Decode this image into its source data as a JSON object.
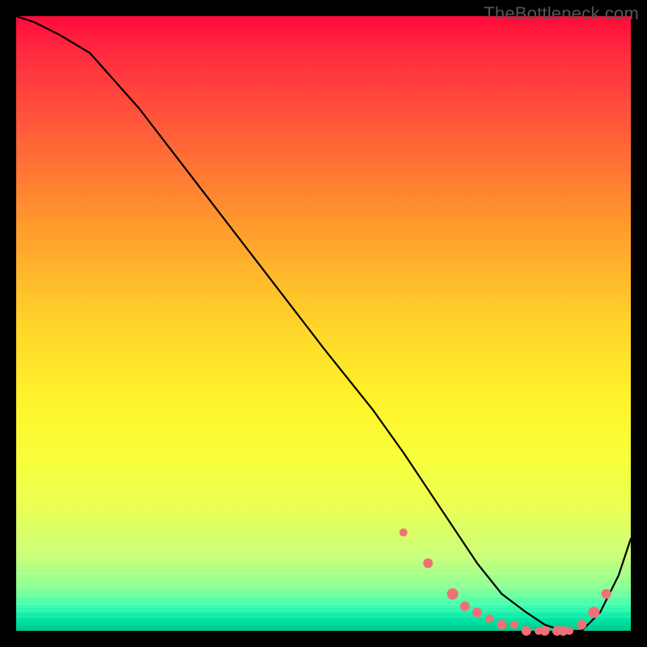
{
  "watermark": "TheBottleneck.com",
  "colors": {
    "background": "#000000",
    "gradient_top": "#ff0a3a",
    "gradient_mid": "#fff22a",
    "gradient_bottom": "#00c98b",
    "curve": "#000000",
    "markers": "#f07078"
  },
  "chart_data": {
    "type": "line",
    "title": "",
    "xlabel": "",
    "ylabel": "",
    "xlim": [
      0,
      100
    ],
    "ylim": [
      0,
      100
    ],
    "grid": false,
    "legend": false,
    "series": [
      {
        "name": "bottleneck-curve",
        "x": [
          0,
          3,
          7,
          12,
          20,
          30,
          40,
          50,
          58,
          63,
          67,
          71,
          75,
          79,
          83,
          86,
          89,
          92,
          95,
          98,
          100
        ],
        "y": [
          100,
          99,
          97,
          94,
          85,
          72,
          59,
          46,
          36,
          29,
          23,
          17,
          11,
          6,
          3,
          1,
          0,
          0,
          3,
          9,
          15
        ]
      }
    ],
    "markers": {
      "name": "valley-points",
      "x": [
        63,
        67,
        71,
        73,
        75,
        77,
        79,
        81,
        83,
        85,
        86,
        88,
        89,
        90,
        92,
        94,
        96
      ],
      "y": [
        16,
        11,
        6,
        4,
        3,
        2,
        1,
        1,
        0,
        0,
        0,
        0,
        0,
        0,
        1,
        3,
        6
      ],
      "r": [
        5,
        6,
        7,
        6,
        6,
        5,
        6,
        5,
        6,
        5,
        6,
        6,
        6,
        5,
        6,
        7,
        6
      ]
    }
  }
}
